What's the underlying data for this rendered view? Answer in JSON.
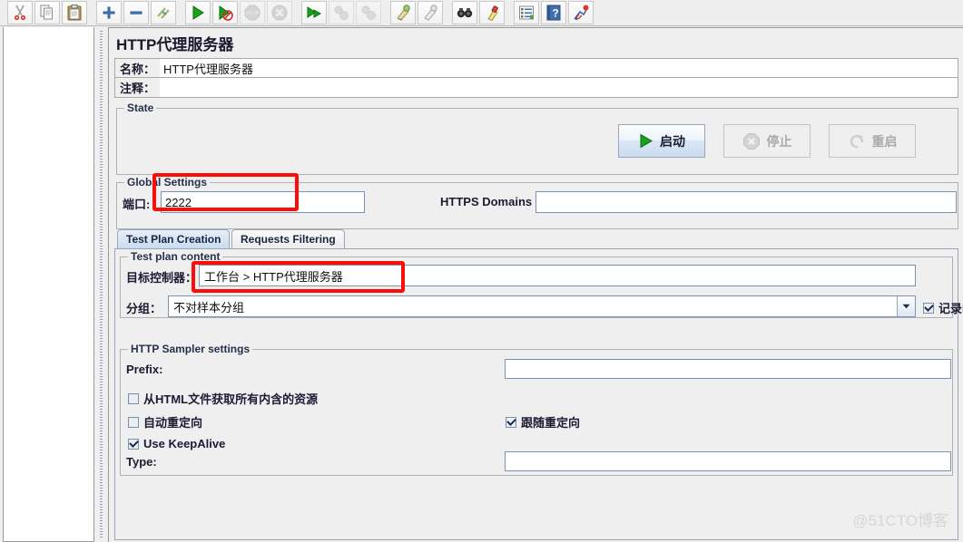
{
  "toolbar": {
    "groups": [
      {
        "buttons": [
          {
            "name": "cut-icon",
            "label": "剪切"
          },
          {
            "name": "copy-icon",
            "label": "复制"
          },
          {
            "name": "paste-icon",
            "label": "粘贴"
          }
        ]
      },
      {
        "buttons": [
          {
            "name": "expand-icon",
            "label": "展开全部"
          },
          {
            "name": "collapse-icon",
            "label": "收起全部"
          },
          {
            "name": "toggle-icon",
            "label": "切换"
          }
        ]
      },
      {
        "buttons": [
          {
            "name": "start-icon",
            "label": "启动"
          },
          {
            "name": "start-no-pauses-icon",
            "label": "无停顿启动"
          },
          {
            "name": "stop-icon",
            "label": "停止",
            "disabled": true
          },
          {
            "name": "shutdown-icon",
            "label": "关闭",
            "disabled": true
          }
        ]
      },
      {
        "buttons": [
          {
            "name": "remote-start-icon",
            "label": "远程启动"
          },
          {
            "name": "remote-stop-icon",
            "label": "远程停止",
            "disabled": true
          },
          {
            "name": "remote-shutdown-icon",
            "label": "远程关闭",
            "disabled": true
          }
        ]
      },
      {
        "buttons": [
          {
            "name": "clear-icon",
            "label": "清除"
          },
          {
            "name": "clear-all-icon",
            "label": "清除全部"
          }
        ]
      },
      {
        "buttons": [
          {
            "name": "search-icon",
            "label": "查找"
          },
          {
            "name": "reset-search-icon",
            "label": "重置查找"
          }
        ]
      },
      {
        "buttons": [
          {
            "name": "function-helper-icon",
            "label": "函数助手对话框"
          },
          {
            "name": "help-icon",
            "label": "帮助"
          },
          {
            "name": "templates-icon",
            "label": "模板"
          }
        ]
      }
    ]
  },
  "panel": {
    "title": "HTTP代理服务器",
    "name_label": "名称：",
    "name_value": "HTTP代理服务器",
    "comment_label": "注释：",
    "comment_value": ""
  },
  "state": {
    "group_title": "State",
    "start_label": "启动",
    "stop_label": "停止",
    "restart_label": "重启"
  },
  "global_settings": {
    "group_title": "Global Settings",
    "port_label": "端口:",
    "port_value": "2222",
    "https_domains_label": "HTTPS Domains :",
    "https_domains_value": ""
  },
  "tabs": [
    {
      "label": "Test Plan Creation",
      "active": true
    },
    {
      "label": "Requests Filtering",
      "active": false
    }
  ],
  "test_plan_content": {
    "group_title": "Test plan content",
    "target_controller_label": "目标控制器：",
    "target_controller_value": "工作台 > HTTP代理服务器",
    "grouping_label": "分组：",
    "grouping_value": "不对样本分组",
    "capture_http_label": "记录HTTP",
    "capture_http_checked": true
  },
  "http_sampler_settings": {
    "group_title": "HTTP Sampler settings",
    "prefix_label": "Prefix:",
    "prefix_value": "",
    "retrieve_embedded_label": "从HTML文件获取所有内含的资源",
    "retrieve_embedded_checked": false,
    "auto_redirect_label": "自动重定向",
    "auto_redirect_checked": false,
    "follow_redirect_label": "跟随重定向",
    "follow_redirect_checked": true,
    "keepalive_label": "Use KeepAlive",
    "keepalive_checked": true,
    "type_label": "Type:",
    "type_value": ""
  },
  "watermark": "@51CTO博客",
  "colors": {
    "annotation_red": "#fb0d09",
    "panel_bg": "#f0efef",
    "tab_active": "#c9dcf0",
    "field_border": "#7d93ad"
  }
}
